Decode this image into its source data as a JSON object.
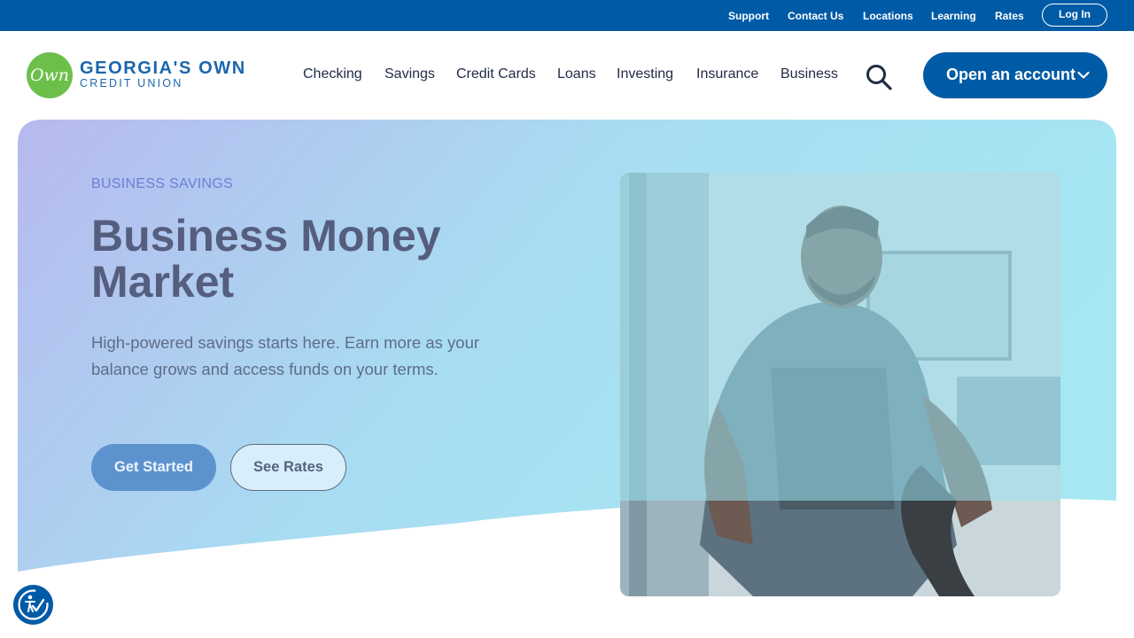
{
  "utility_bar": {
    "links": [
      "Support",
      "Contact Us",
      "Locations",
      "Learning",
      "Rates"
    ],
    "login_label": "Log In"
  },
  "brand": {
    "logo_mark": "Own",
    "name_line1": "GEORGIA'S OWN",
    "name_line2": "CREDIT UNION"
  },
  "nav": {
    "items": [
      "Checking",
      "Savings",
      "Credit Cards",
      "Loans",
      "Investing",
      "Insurance",
      "Business"
    ],
    "search_icon": "search-icon",
    "cta_label": "Open an account",
    "cta_icon": "chevron-down-icon"
  },
  "hero": {
    "eyebrow": "BUSINESS SAVINGS",
    "title": "Business Money Market",
    "subtitle": "High-powered savings starts here. Earn more as your balance grows and access funds on your terms.",
    "primary_button": "Get Started",
    "secondary_button": "See Rates"
  },
  "accessibility": {
    "icon": "accessibility-icon"
  },
  "colors": {
    "brand_blue": "#005ba6",
    "logo_green": "#6cc04a",
    "hero_gradient_start": "#b7b9ee",
    "hero_gradient_end": "#a6e7f3"
  }
}
